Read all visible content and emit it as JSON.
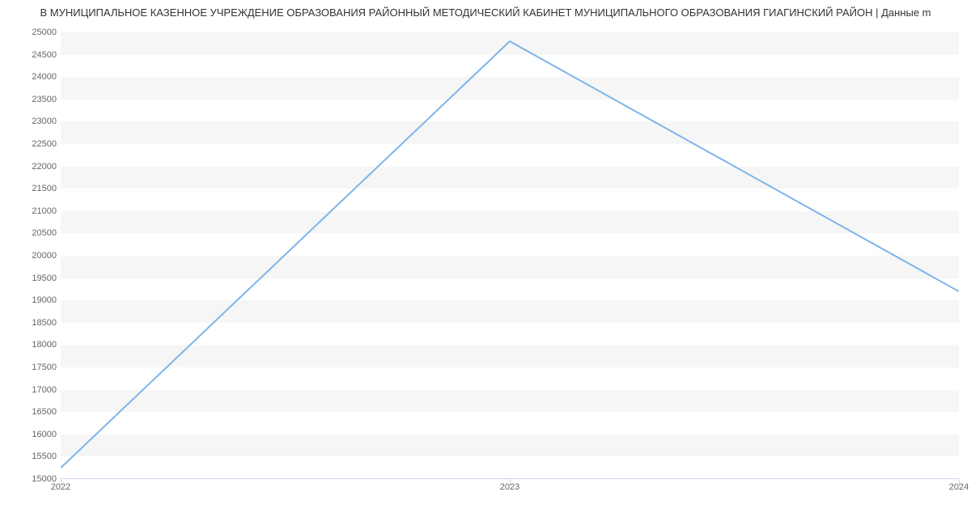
{
  "title": "В МУНИЦИПАЛЬНОЕ КАЗЕННОЕ УЧРЕЖДЕНИЕ ОБРАЗОВАНИЯ РАЙОННЫЙ МЕТОДИЧЕСКИЙ КАБИНЕТ МУНИЦИПАЛЬНОГО ОБРАЗОВАНИЯ ГИАГИНСКИЙ РАЙОН | Данные m",
  "chart_data": {
    "type": "line",
    "x": [
      2022,
      2023,
      2024
    ],
    "values": [
      15250,
      24800,
      19200
    ],
    "title": "В МУНИЦИПАЛЬНОЕ КАЗЕННОЕ УЧРЕЖДЕНИЕ ОБРАЗОВАНИЯ РАЙОННЫЙ МЕТОДИЧЕСКИЙ КАБИНЕТ МУНИЦИПАЛЬНОГО ОБРАЗОВАНИЯ ГИАГИНСКИЙ РАЙОН | Данные m",
    "xlabel": "",
    "ylabel": "",
    "ylim": [
      15000,
      25000
    ],
    "y_ticks": [
      15000,
      15500,
      16000,
      16500,
      17000,
      17500,
      18000,
      18500,
      19000,
      19500,
      20000,
      20500,
      21000,
      21500,
      22000,
      22500,
      23000,
      23500,
      24000,
      24500,
      25000
    ],
    "x_ticks": [
      2022,
      2023,
      2024
    ]
  },
  "axis": {
    "x": {
      "tick_0": "2022",
      "tick_1": "2023",
      "tick_2": "2024"
    },
    "y": {
      "tick_0": "15000",
      "tick_1": "15500",
      "tick_2": "16000",
      "tick_3": "16500",
      "tick_4": "17000",
      "tick_5": "17500",
      "tick_6": "18000",
      "tick_7": "18500",
      "tick_8": "19000",
      "tick_9": "19500",
      "tick_10": "20000",
      "tick_11": "20500",
      "tick_12": "21000",
      "tick_13": "21500",
      "tick_14": "22000",
      "tick_15": "22500",
      "tick_16": "23000",
      "tick_17": "23500",
      "tick_18": "24000",
      "tick_19": "24500",
      "tick_20": "25000"
    }
  },
  "colors": {
    "line": "#7cb5ec",
    "grid_alt": "#f6f6f6"
  }
}
